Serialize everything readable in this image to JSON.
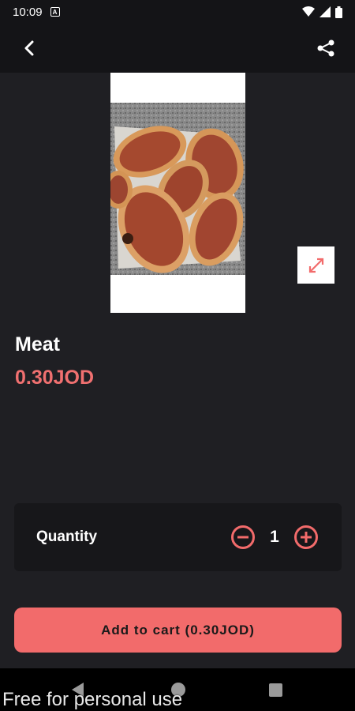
{
  "status_bar": {
    "time": "10:09",
    "notification_icon": "notification-a-icon",
    "right_icons": [
      "wifi-icon",
      "signal-icon",
      "battery-icon"
    ]
  },
  "toolbar": {
    "back_icon": "back-arrow-icon",
    "share_icon": "share-icon"
  },
  "product": {
    "image_description_icon": "product-photo",
    "expand_icon": "expand-icon",
    "name": "Meat",
    "price": "0.30JOD"
  },
  "quantity": {
    "label": "Quantity",
    "value": "1",
    "decrement_icon": "minus-circle-icon",
    "increment_icon": "plus-circle-icon"
  },
  "cart_button": {
    "label": "Add to cart (0.30JOD)"
  },
  "watermark": "Free for personal use",
  "colors": {
    "background": "#1f1f23",
    "accent": "#f26b6b",
    "price": "#f07070",
    "card": "#17171a"
  }
}
